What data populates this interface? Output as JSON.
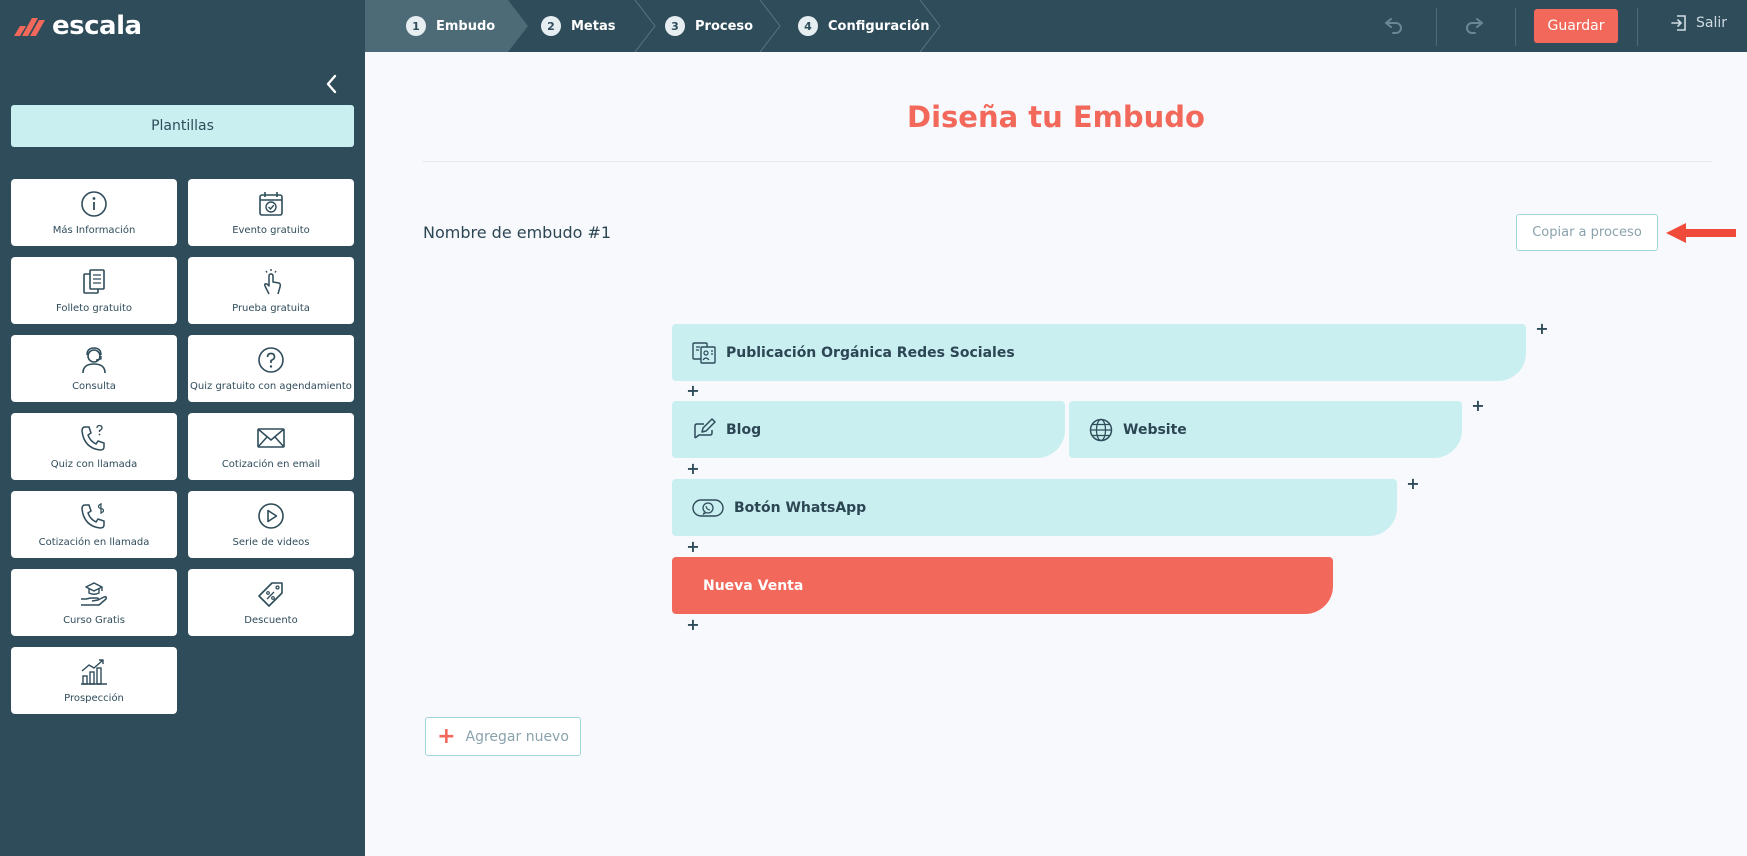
{
  "app": {
    "logo_text": "escala",
    "colors": {
      "primary_dark": "#2f4c5a",
      "accent": "#f2685a",
      "light_teal": "#c9eff1"
    }
  },
  "header": {
    "steps": [
      {
        "num": "1",
        "label": "Embudo"
      },
      {
        "num": "2",
        "label": "Metas"
      },
      {
        "num": "3",
        "label": "Proceso"
      },
      {
        "num": "4",
        "label": "Configuración"
      }
    ],
    "undo_icon": "undo-icon",
    "redo_icon": "redo-icon",
    "save_label": "Guardar",
    "exit_label": "Salir"
  },
  "sidebar": {
    "templates_label": "Plantillas",
    "cards": [
      {
        "label": "Más Información",
        "icon": "info-icon"
      },
      {
        "label": "Evento gratuito",
        "icon": "calendar-check-icon"
      },
      {
        "label": "Folleto gratuito",
        "icon": "brochure-icon"
      },
      {
        "label": "Prueba gratuita",
        "icon": "hand-click-icon"
      },
      {
        "label": "Consulta",
        "icon": "consultant-icon"
      },
      {
        "label": "Quiz gratuito con agendamiento",
        "icon": "question-circle-icon"
      },
      {
        "label": "Quiz con llamada",
        "icon": "phone-question-icon"
      },
      {
        "label": "Cotización en email",
        "icon": "envelope-icon"
      },
      {
        "label": "Cotización en llamada",
        "icon": "phone-dollar-icon"
      },
      {
        "label": "Serie de videos",
        "icon": "play-circle-icon"
      },
      {
        "label": "Curso Gratis",
        "icon": "graduation-hand-icon"
      },
      {
        "label": "Descuento",
        "icon": "discount-tag-icon"
      },
      {
        "label": "Prospección",
        "icon": "growth-chart-icon"
      }
    ]
  },
  "main": {
    "title": "Diseña tu Embudo",
    "funnel_name": "Nombre de embudo #1",
    "copy_label": "Copiar a proceso",
    "funnel_stages": [
      {
        "label": "Publicación Orgánica Redes Sociales",
        "icon": "social-post-icon"
      },
      {
        "label": "Blog",
        "icon": "blog-edit-icon"
      },
      {
        "label": "Website",
        "icon": "globe-icon"
      },
      {
        "label": "Botón WhatsApp",
        "icon": "whatsapp-icon"
      },
      {
        "label": "Nueva Venta",
        "icon": ""
      }
    ],
    "plus_symbol": "+",
    "add_new_label": "Agregar nuevo"
  }
}
